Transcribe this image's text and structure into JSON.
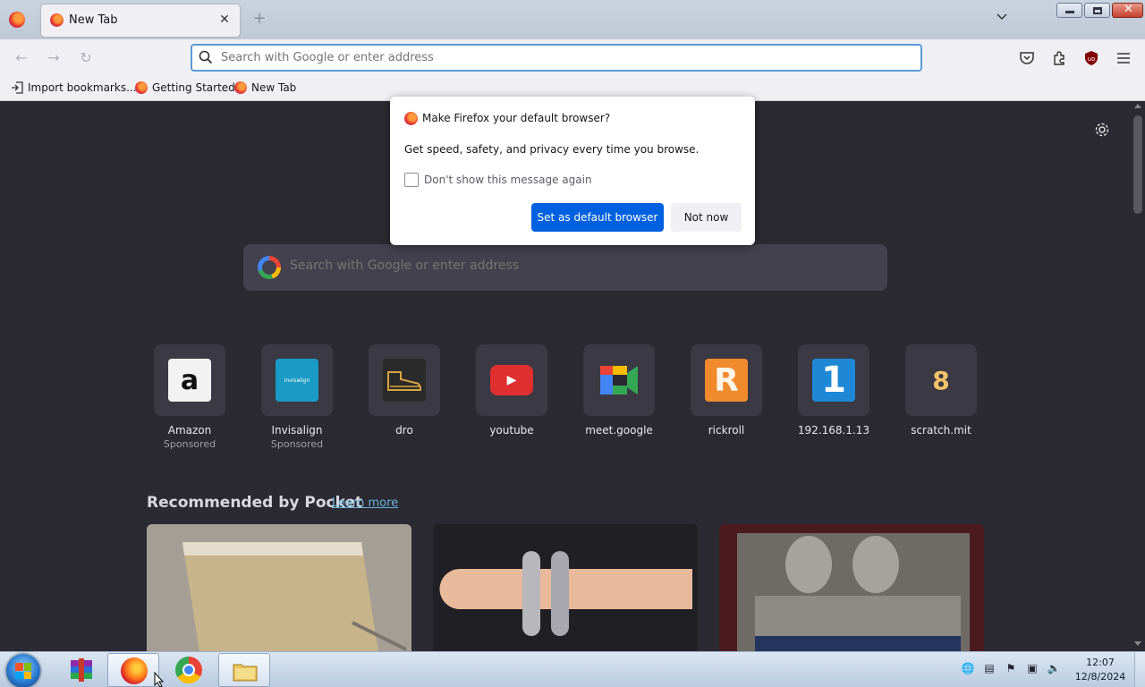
{
  "browser": {
    "tab": {
      "title": "New Tab",
      "close_glyph": "✕"
    },
    "new_tab_glyph": "+",
    "urlbar": {
      "placeholder": "Search with Google or enter address"
    },
    "bookmarks": [
      {
        "label": "Import bookmarks...",
        "icon": "import-icon"
      },
      {
        "label": "Getting Started",
        "icon": "firefox-icon"
      },
      {
        "label": "New Tab",
        "icon": "firefox-icon"
      }
    ]
  },
  "newtab": {
    "search_placeholder": "Search with Google or enter address",
    "tiles": [
      {
        "label": "Amazon",
        "sponsor": "Sponsored",
        "icon": "amazon-icon",
        "bg": "#f2f2f2",
        "glyph": "a"
      },
      {
        "label": "Invisalign",
        "sponsor": "Sponsored",
        "icon": "invisalign-icon",
        "bg": "#1a9bc5",
        "glyph": "invisalign"
      },
      {
        "label": "dro",
        "sponsor": "",
        "icon": "shoe-icon",
        "bg": "#2a2a2a",
        "glyph": "👟"
      },
      {
        "label": "youtube",
        "sponsor": "",
        "icon": "youtube-icon",
        "bg": "#e02f2f",
        "glyph": "▶"
      },
      {
        "label": "meet.google",
        "sponsor": "",
        "icon": "google-meet-icon",
        "bg": "#3a3944",
        "glyph": ""
      },
      {
        "label": "rickroll",
        "sponsor": "",
        "icon": "rickroll-icon",
        "bg": "#f08a2c",
        "glyph": "R"
      },
      {
        "label": "192.168.1.13",
        "sponsor": "",
        "icon": "number-one-icon",
        "bg": "#1e88d6",
        "glyph": "1"
      },
      {
        "label": "scratch.mit",
        "sponsor": "",
        "icon": "scratch-icon",
        "bg": "#3a3944",
        "glyph": "8"
      }
    ],
    "pocket": {
      "title": "Recommended by Pocket",
      "learn_more": "Learn more"
    }
  },
  "dialog": {
    "title": "Make Firefox your default browser?",
    "text": "Get speed, safety, and privacy every time you browse.",
    "checkbox_label": "Don't show this message again",
    "checkbox_checked": false,
    "primary_label": "Set as default browser",
    "secondary_label": "Not now"
  },
  "taskbar": {
    "time": "12:07",
    "date": "12/8/2024"
  },
  "colors": {
    "accent": "#0061e0",
    "content_bg": "#2b2a33",
    "link": "#6bb3d8"
  }
}
